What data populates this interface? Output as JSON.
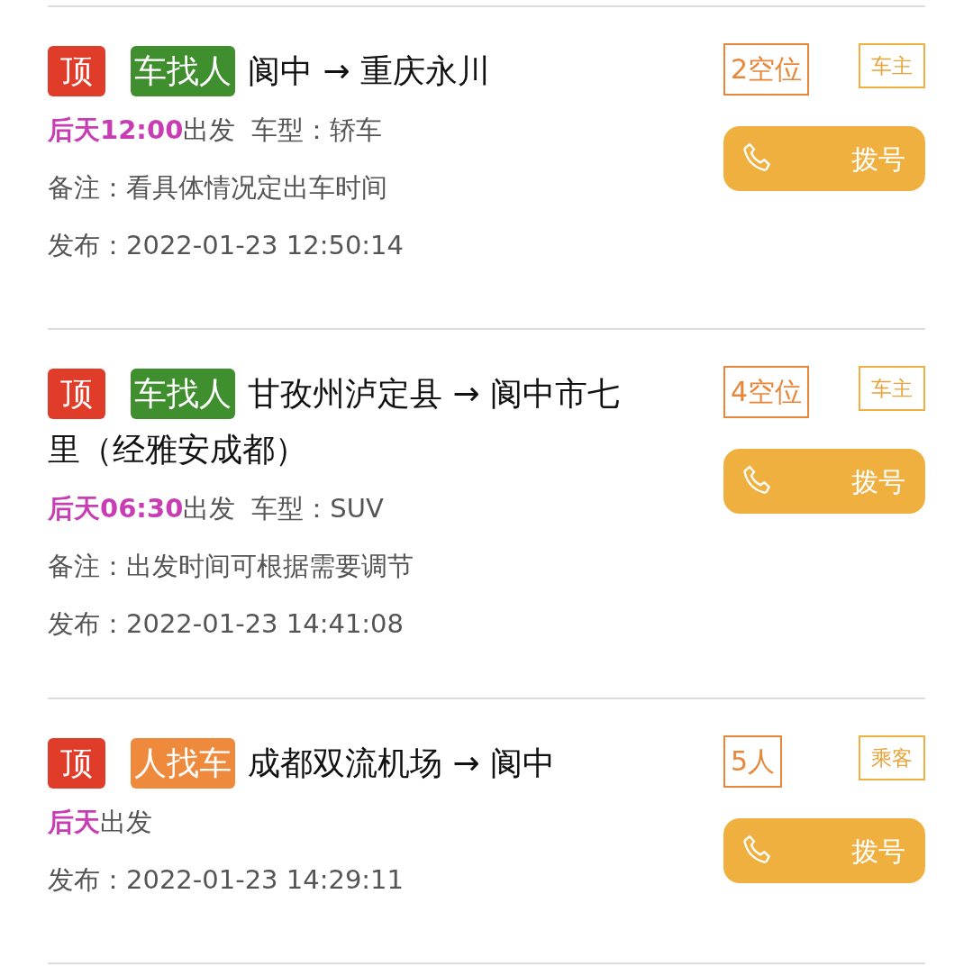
{
  "listings": [
    {
      "pin": "顶",
      "type": {
        "kind": "car",
        "label": "车找人"
      },
      "route_lines": [
        "阆中 → 重庆永川"
      ],
      "departure": {
        "when": "后天12:00",
        "suffix": "出发"
      },
      "car_type": "车型：轿车",
      "note": "备注：看具体情况定出车时间",
      "published": "发布：2022-01-23 12:50:14",
      "seats": "2空位",
      "role": "车主",
      "dial": "拨号"
    },
    {
      "pin": "顶",
      "type": {
        "kind": "car",
        "label": "车找人"
      },
      "route_lines": [
        "甘孜州泸定县 → 阆中市七",
        "里（经雅安成都）"
      ],
      "departure": {
        "when": "后天06:30",
        "suffix": "出发"
      },
      "car_type": "车型：SUV",
      "note": "备注：出发时间可根据需要调节",
      "published": "发布：2022-01-23 14:41:08",
      "seats": "4空位",
      "role": "车主",
      "dial": "拨号"
    },
    {
      "pin": "顶",
      "type": {
        "kind": "person",
        "label": "人找车"
      },
      "route_lines": [
        "成都双流机场 → 阆中"
      ],
      "departure": {
        "when": "后天",
        "suffix": "出发"
      },
      "published": "发布：2022-01-23 14:29:11",
      "seats": "5人",
      "role": "乘客",
      "dial": "拨号"
    }
  ]
}
